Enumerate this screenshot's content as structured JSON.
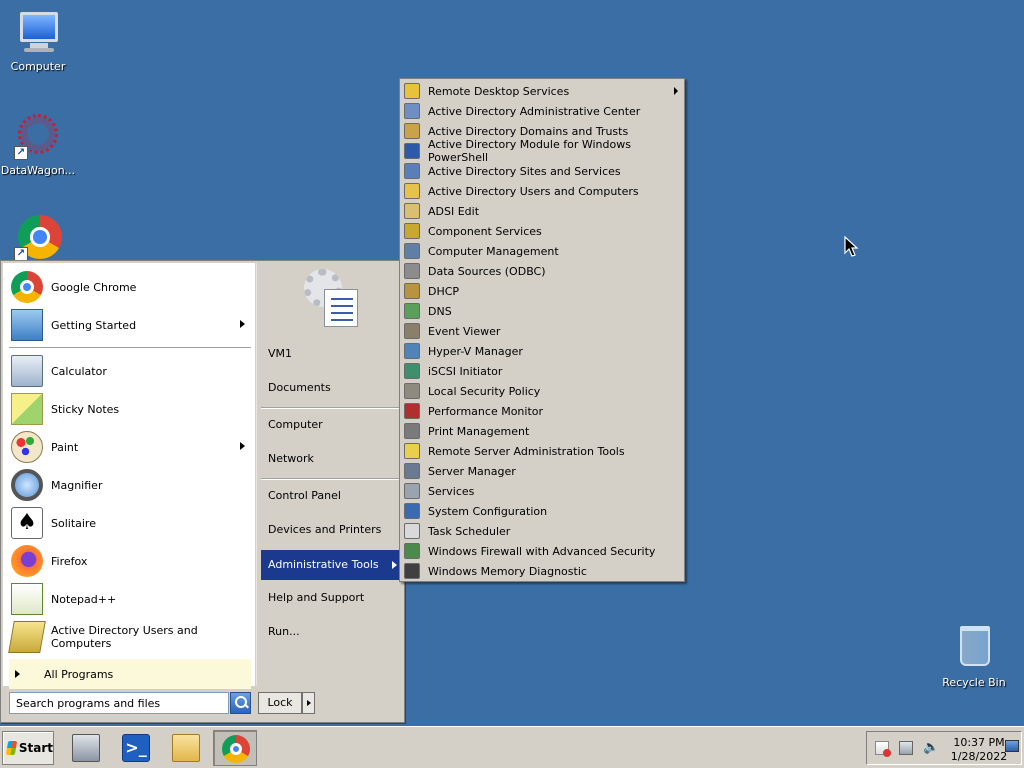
{
  "desktop": {
    "icons": [
      {
        "label": "Computer",
        "icon": "computer-icon"
      },
      {
        "label": "DataWagon...",
        "icon": "datawagon-icon"
      },
      {
        "label": "Recycle Bin",
        "icon": "recycle-bin-icon"
      }
    ]
  },
  "start_menu": {
    "pinned": [
      {
        "label": "Google Chrome",
        "icon": "chrome-icon"
      },
      {
        "label": "Getting Started",
        "icon": "getting-started-icon",
        "has_submenu": true
      }
    ],
    "recent": [
      {
        "label": "Calculator",
        "icon": "calculator-icon"
      },
      {
        "label": "Sticky Notes",
        "icon": "sticky-notes-icon"
      },
      {
        "label": "Paint",
        "icon": "paint-icon",
        "has_submenu": true
      },
      {
        "label": "Magnifier",
        "icon": "magnifier-icon"
      },
      {
        "label": "Solitaire",
        "icon": "solitaire-icon"
      },
      {
        "label": "Firefox",
        "icon": "firefox-icon"
      },
      {
        "label": "Notepad++",
        "icon": "notepadpp-icon"
      },
      {
        "label": "Active Directory Users and Computers",
        "icon": "ad-users-icon"
      }
    ],
    "all_programs": "All Programs",
    "search_placeholder": "Search programs and files",
    "lock_label": "Lock",
    "right_links": [
      {
        "label": "VM1"
      },
      {
        "label": "Documents"
      },
      {
        "label": "Computer"
      },
      {
        "label": "Network"
      },
      {
        "label": "Control Panel"
      },
      {
        "label": "Devices and Printers"
      },
      {
        "label": "Administrative Tools",
        "active": true
      },
      {
        "label": "Help and Support"
      },
      {
        "label": "Run..."
      }
    ]
  },
  "admin_tools_menu": {
    "items": [
      {
        "label": "Remote Desktop Services",
        "color": "#e8c23a",
        "has_submenu": true
      },
      {
        "label": "Active Directory Administrative Center",
        "color": "#6f8fc4"
      },
      {
        "label": "Active Directory Domains and Trusts",
        "color": "#c9a24a"
      },
      {
        "label": "Active Directory Module for Windows PowerShell",
        "color": "#2d5aa8"
      },
      {
        "label": "Active Directory Sites and Services",
        "color": "#5a7fb8"
      },
      {
        "label": "Active Directory Users and Computers",
        "color": "#e6c14b"
      },
      {
        "label": "ADSI Edit",
        "color": "#d8c070"
      },
      {
        "label": "Component Services",
        "color": "#c8a830"
      },
      {
        "label": "Computer Management",
        "color": "#5f7ea8"
      },
      {
        "label": "Data Sources (ODBC)",
        "color": "#8c8c8c"
      },
      {
        "label": "DHCP",
        "color": "#b89440"
      },
      {
        "label": "DNS",
        "color": "#5aa05a"
      },
      {
        "label": "Event Viewer",
        "color": "#8a7f6a"
      },
      {
        "label": "Hyper-V Manager",
        "color": "#4f84b8"
      },
      {
        "label": "iSCSI Initiator",
        "color": "#3f8f6f"
      },
      {
        "label": "Local Security Policy",
        "color": "#8f8a80"
      },
      {
        "label": "Performance Monitor",
        "color": "#b03030"
      },
      {
        "label": "Print Management",
        "color": "#7a7a7a"
      },
      {
        "label": "Remote Server Administration Tools",
        "color": "#e8d04a"
      },
      {
        "label": "Server Manager",
        "color": "#6a7a90"
      },
      {
        "label": "Services",
        "color": "#9aa4b0"
      },
      {
        "label": "System Configuration",
        "color": "#3a6ab0"
      },
      {
        "label": "Task Scheduler",
        "color": "#d9d9d9"
      },
      {
        "label": "Windows Firewall with Advanced Security",
        "color": "#4c8a4c"
      },
      {
        "label": "Windows Memory Diagnostic",
        "color": "#404040"
      }
    ]
  },
  "taskbar": {
    "start_label": "Start",
    "buttons": [
      {
        "name": "server-manager",
        "icon": "server-manager-icon"
      },
      {
        "name": "powershell",
        "icon": "powershell-icon"
      },
      {
        "name": "explorer",
        "icon": "folder-icon"
      },
      {
        "name": "chrome",
        "icon": "chrome-icon",
        "active": true
      }
    ],
    "clock_time": "10:37 PM",
    "clock_date": "1/28/2022"
  },
  "colors": {
    "desktop_bg": "#3a6ea5",
    "menu_bg": "#d4d0c8",
    "selection": "#1b3a8f"
  }
}
